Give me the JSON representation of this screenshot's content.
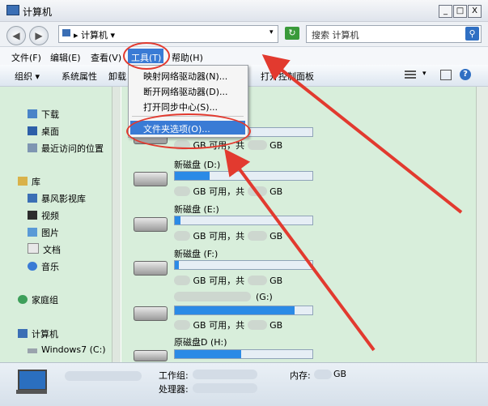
{
  "window": {
    "title": "计算机",
    "min_label": "_",
    "max_label": "□",
    "close_label": "X"
  },
  "address": {
    "back_label": "◀",
    "forward_label": "▶",
    "path": "▸ 计算机 ▾",
    "dropdown_arrow": "▾",
    "refresh_label": "↻",
    "search_placeholder": "搜索 计算机",
    "search_icon": "search-icon"
  },
  "menubar": [
    "文件(F)",
    "编辑(E)",
    "查看(V)",
    "工具(T)",
    "帮助(H)"
  ],
  "toolbar": {
    "organize": "组织 ▾",
    "properties": "系统属性",
    "uninstall": "卸载",
    "control_panel": "打开控制面板"
  },
  "tools_menu": {
    "items": [
      "映射网络驱动器(N)...",
      "断开网络驱动器(D)...",
      "打开同步中心(S)...",
      "文件夹选项(O)..."
    ]
  },
  "nav": {
    "favorites": [
      "下载",
      "桌面",
      "最近访问的位置"
    ],
    "library": "库",
    "library_items": [
      "暴风影视库",
      "视频",
      "图片",
      "文档",
      "音乐"
    ],
    "homegroup": "家庭组",
    "computer": "计算机",
    "computer_items": [
      "Windows7 (C:)"
    ]
  },
  "drives": [
    {
      "name": "",
      "info": "GB 可用，共",
      "info_end": "GB",
      "fill": 0.05
    },
    {
      "name": "新磁盘 (D:)",
      "info": "GB 可用，共",
      "info_end": "GB",
      "fill": 0.25
    },
    {
      "name": "新磁盘 (E:)",
      "info": "GB 可用，共",
      "info_end": "GB",
      "fill": 0.04
    },
    {
      "name": "新磁盘 (F:)",
      "info": "GB 可用，共",
      "info_end": "GB",
      "fill": 0.03
    },
    {
      "name": "(G:)",
      "info": "GB 可用，共",
      "info_end": "GB",
      "fill": 0.87
    },
    {
      "name": "原磁盘D (H:)",
      "info": "",
      "info_end": "",
      "fill": 0.48
    }
  ],
  "status": {
    "workgroup": "工作组:",
    "memory": "内存:",
    "memory_unit": "GB",
    "processor": "处理器:"
  },
  "colors": {
    "accent": "#3a7bd5",
    "annotation": "#e23a2f",
    "nav_bg": "#d8eedb",
    "bar_fill": "#2b8ae6"
  }
}
